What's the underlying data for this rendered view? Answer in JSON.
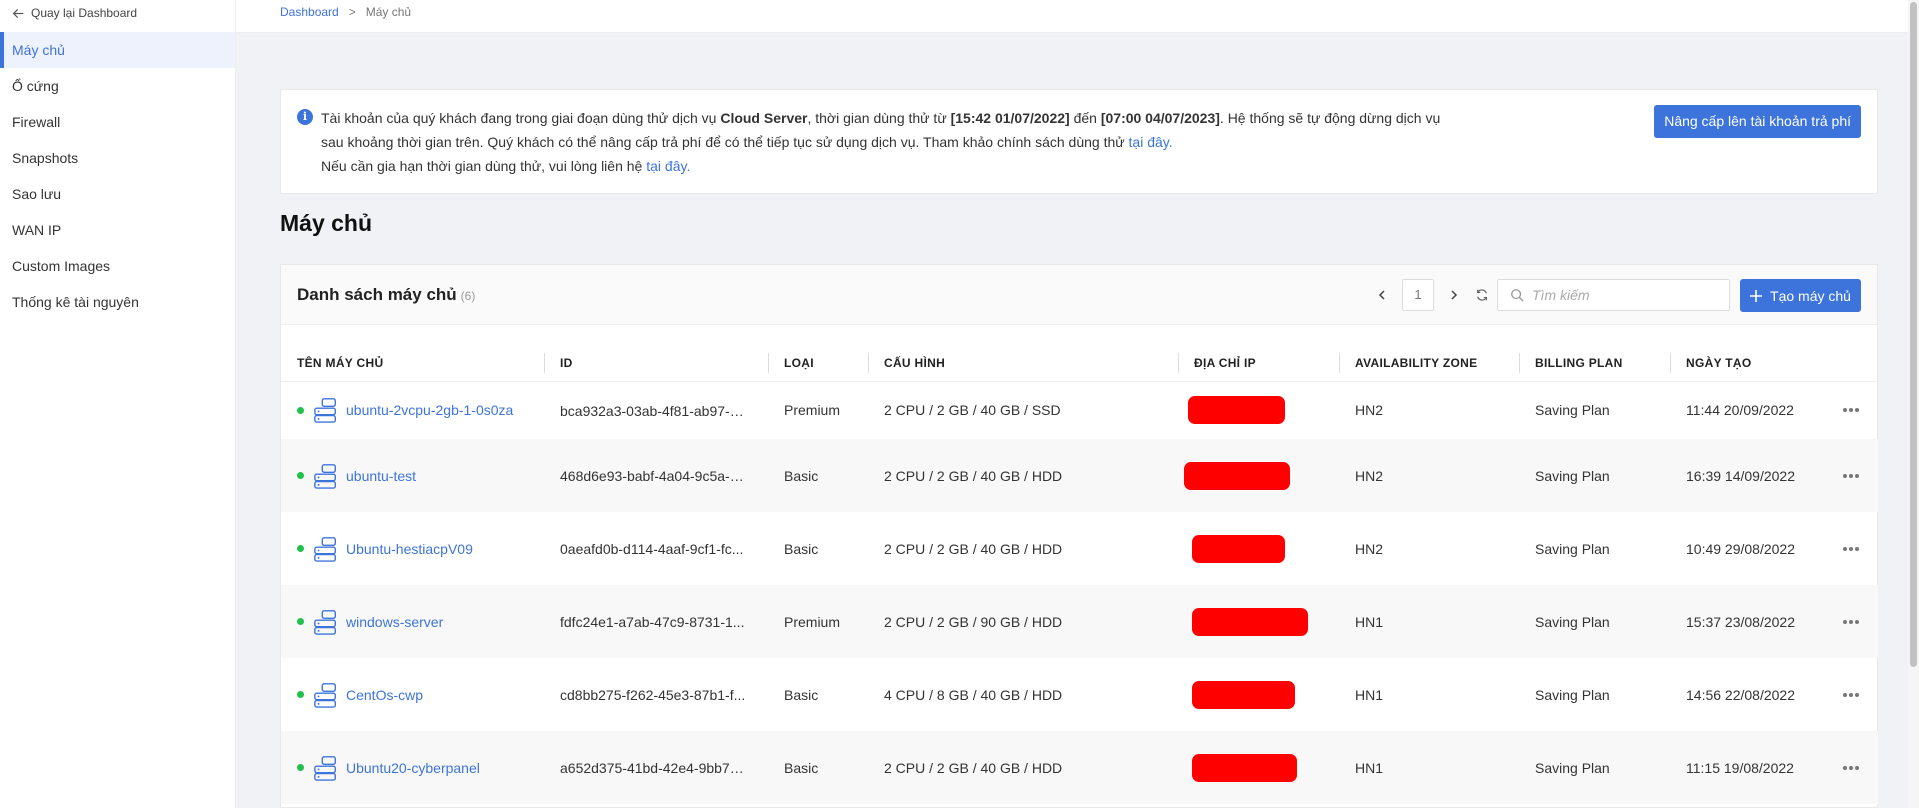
{
  "sidebar": {
    "back_label": "Quay lại Dashboard",
    "items": [
      {
        "label": "Máy chủ",
        "active": true
      },
      {
        "label": "Ổ cứng"
      },
      {
        "label": "Firewall"
      },
      {
        "label": "Snapshots"
      },
      {
        "label": "Sao lưu"
      },
      {
        "label": "WAN IP"
      },
      {
        "label": "Custom Images"
      },
      {
        "label": "Thống kê tài nguyên"
      }
    ]
  },
  "breadcrumb": {
    "root": "Dashboard",
    "separator": ">",
    "current": "Máy chủ"
  },
  "notice": {
    "t1": "Tài khoản của quý khách đang trong giai đoạn dùng thử dịch vụ ",
    "service": "Cloud Server",
    "t2": ", thời gian dùng thử từ ",
    "start": "[15:42 01/07/2022]",
    "t3": " đến ",
    "end": "[07:00 04/07/2023]",
    "t4": ". Hệ thống sẽ tự động dừng dịch vụ sau khoảng thời gian trên. Quý khách có thể nâng cấp trả phí để có thể tiếp tục sử dụng dịch vụ. Tham khảo chính sách dùng thử ",
    "link1": "tại đây.",
    "t5": "Nếu cần gia hạn thời gian dùng thử, vui lòng liên hệ ",
    "link2": "tại đây.",
    "upgrade_label": "Nâng cấp lên tài khoản trả phí"
  },
  "page_title": "Máy chủ",
  "list": {
    "title": "Danh sách máy chủ",
    "count": "(6)",
    "page": "1",
    "search_placeholder": "Tìm kiếm",
    "create_label": "Tạo máy chủ",
    "columns": [
      "TÊN MÁY CHỦ",
      "ID",
      "LOẠI",
      "CẤU HÌNH",
      "ĐỊA CHỈ IP",
      "AVAILABILITY ZONE",
      "BILLING PLAN",
      "NGÀY TẠO"
    ],
    "rows": [
      {
        "name": "ubuntu-2vcpu-2gb-1-0s0za",
        "id": "bca932a3-03ab-4f81-ab97-6...",
        "type": "Premium",
        "config": "2 CPU / 2 GB / 40 GB / SSD",
        "zone": "HN2",
        "plan": "Saving Plan",
        "created": "11:44 20/09/2022"
      },
      {
        "name": "ubuntu-test",
        "id": "468d6e93-babf-4a04-9c5a-4...",
        "type": "Basic",
        "config": "2 CPU / 2 GB / 40 GB / HDD",
        "zone": "HN2",
        "plan": "Saving Plan",
        "created": "16:39 14/09/2022"
      },
      {
        "name": "Ubuntu-hestiacpV09",
        "id": "0aeafd0b-d114-4aaf-9cf1-fc...",
        "type": "Basic",
        "config": "2 CPU / 2 GB / 40 GB / HDD",
        "zone": "HN2",
        "plan": "Saving Plan",
        "created": "10:49 29/08/2022"
      },
      {
        "name": "windows-server",
        "id": "fdfc24e1-a7ab-47c9-8731-1...",
        "type": "Premium",
        "config": "2 CPU / 2 GB / 90 GB / HDD",
        "zone": "HN1",
        "plan": "Saving Plan",
        "created": "15:37 23/08/2022"
      },
      {
        "name": "CentOs-cwp",
        "id": "cd8bb275-f262-45e3-87b1-f...",
        "type": "Basic",
        "config": "4 CPU / 8 GB / 40 GB / HDD",
        "zone": "HN1",
        "plan": "Saving Plan",
        "created": "14:56 22/08/2022"
      },
      {
        "name": "Ubuntu20-cyberpanel",
        "id": "a652d375-41bd-42e4-9bb7-...",
        "type": "Basic",
        "config": "2 CPU / 2 GB / 40 GB / HDD",
        "zone": "HN1",
        "plan": "Saving Plan",
        "created": "11:15 19/08/2022"
      }
    ]
  },
  "colors": {
    "accent": "#3d74dc",
    "status_running": "#21c04a",
    "redaction": "#ff0000"
  }
}
